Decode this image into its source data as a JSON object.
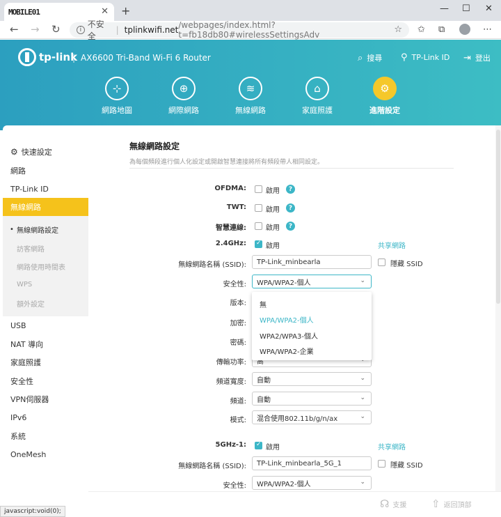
{
  "browser": {
    "tab_title": "MOBILE01",
    "url_insecure": "不安全",
    "url_host": "tplinkwifi.net",
    "url_path": "/webpages/index.html?t=fb18db80#wirelessSettingsAdv"
  },
  "header": {
    "logo": "tp-link",
    "model": "AX6600 Tri-Band Wi-Fi 6 Router",
    "search": "搜尋",
    "account": "TP-Link ID",
    "logout": "登出"
  },
  "nav": [
    {
      "label": "網路地圖",
      "icon": "network-map-icon"
    },
    {
      "label": "網際網路",
      "icon": "globe-icon"
    },
    {
      "label": "無線網路",
      "icon": "wifi-icon"
    },
    {
      "label": "家庭照護",
      "icon": "home-care-icon"
    },
    {
      "label": "進階設定",
      "icon": "gear-icon"
    }
  ],
  "sidebar": {
    "items": [
      "快速設定",
      "網路",
      "TP-Link ID",
      "無線網路"
    ],
    "subitems": [
      "無線網路設定",
      "訪客網路",
      "網路使用時間表",
      "WPS",
      "額外設定"
    ],
    "items2": [
      "USB",
      "NAT 導向",
      "家庭照護",
      "安全性",
      "VPN伺服器",
      "IPv6",
      "系統",
      "OneMesh"
    ]
  },
  "section": {
    "title": "無線網路設定",
    "desc": "為每個頻段進行個人化設定或開啟智慧連接將所有頻段帶人相同設定。"
  },
  "form": {
    "ofdma": "OFDMA:",
    "twt": "TWT:",
    "smart_connect": "智慧連線:",
    "enable": "啟用",
    "band24": "2.4GHz:",
    "share_network": "共享網路",
    "ssid_label": "無線網路名稱 (SSID):",
    "ssid_24": "TP-Link_minbearla",
    "hide_ssid": "隱藏 SSID",
    "security_label": "安全性:",
    "security_value": "WPA/WPA2-個人",
    "version_label": "版本:",
    "encryption_label": "加密:",
    "password_label": "密碼:",
    "tx_power_label": "傳輸功率:",
    "tx_power_value": "高",
    "channel_width_label": "頻道寬度:",
    "channel_width_value": "自動",
    "channel_label": "頻道:",
    "channel_value": "自動",
    "mode_label": "模式:",
    "mode_value": "混合使用802.11b/g/n/ax",
    "band5": "5GHz-1:",
    "ssid_5": "TP-Link_minbearla_5G_1",
    "security_5_value": "WPA/WPA2-個人"
  },
  "dropdown": [
    "無",
    "WPA/WPA2-個人",
    "WPA2/WPA3-個人",
    "WPA/WPA2-企業"
  ],
  "footer": {
    "support": "支援",
    "back_top": "返回頂部",
    "status": "javascript:void(0);"
  }
}
